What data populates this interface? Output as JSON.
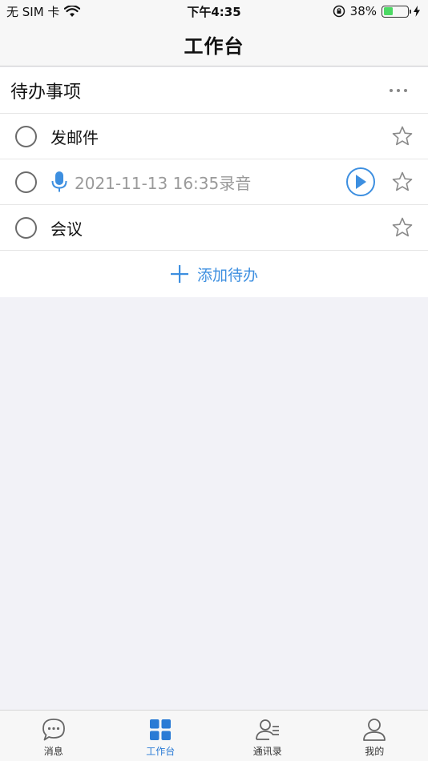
{
  "status_bar": {
    "carrier": "无 SIM 卡",
    "time": "下午4:35",
    "battery_percent": "38%",
    "battery_level": 0.38
  },
  "nav": {
    "title": "工作台"
  },
  "todo_card": {
    "title": "待办事项",
    "items": [
      {
        "type": "text",
        "label": "发邮件",
        "checked": false,
        "starred": false
      },
      {
        "type": "voice",
        "label": "2021-11-13 16:35录音",
        "checked": false,
        "starred": false
      },
      {
        "type": "text",
        "label": "会议",
        "checked": false,
        "starred": false
      }
    ],
    "add_label": "添加待办"
  },
  "tabs": [
    {
      "label": "消息",
      "icon": "chat-bubble-icon",
      "active": false
    },
    {
      "label": "工作台",
      "icon": "grid-icon",
      "active": true
    },
    {
      "label": "通讯录",
      "icon": "contacts-icon",
      "active": false
    },
    {
      "label": "我的",
      "icon": "person-icon",
      "active": false
    }
  ],
  "colors": {
    "accent": "#3d8fe0",
    "battery": "#4cd964",
    "background": "#f2f2f7"
  }
}
